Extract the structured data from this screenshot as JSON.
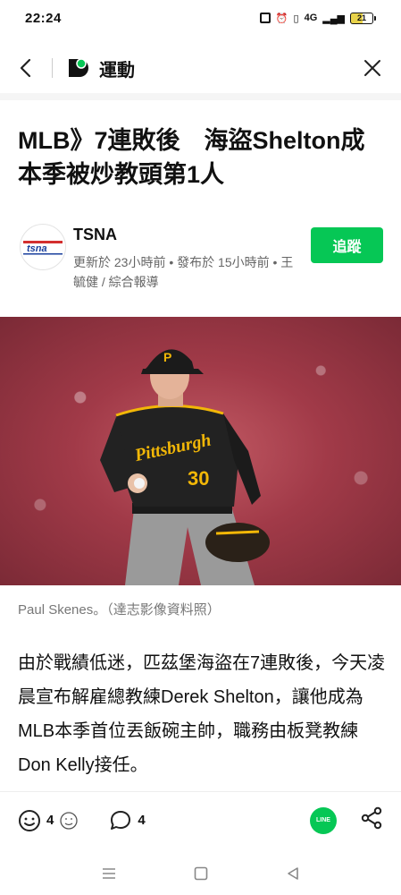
{
  "status_bar": {
    "time": "22:24",
    "network": "4G",
    "battery": "21"
  },
  "app_bar": {
    "title": "運動"
  },
  "article": {
    "headline": "MLB》7連敗後　海盜Shelton成本季被炒教頭第1人",
    "source_name": "TSNA",
    "source_logo_text": "tsna",
    "meta": "更新於 23小時前 • 發布於 15小時前 • 王毓健 / 綜合報導",
    "follow_label": "追蹤",
    "jersey_text": "Pittsburgh",
    "jersey_number": "30",
    "cap_letter": "P",
    "caption": "Paul Skenes。（達志影像資料照）",
    "body": "由於戰績低迷，匹茲堡海盜在7連敗後，今天凌晨宣布解雇總教練Derek Shelton，讓他成為MLB本季首位丟飯碗主帥，職務由板凳教練Don Kelly接任。"
  },
  "bottom_bar": {
    "reaction_count": "4",
    "comment_count": "4",
    "line_label": "LINE"
  },
  "colors": {
    "accent": "#06c755",
    "text": "#111111",
    "muted": "#666666"
  }
}
